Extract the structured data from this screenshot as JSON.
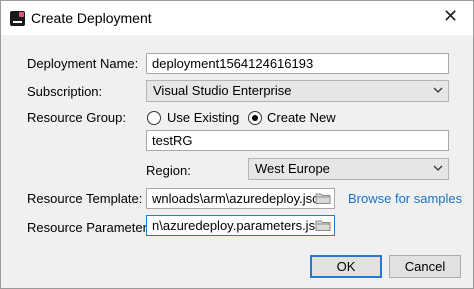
{
  "window": {
    "title": "Create Deployment",
    "close_glyph": "✕"
  },
  "form": {
    "deployment_name_label": "Deployment Name:",
    "deployment_name_value": "deployment1564124616193",
    "subscription_label": "Subscription:",
    "subscription_value": "Visual Studio Enterprise",
    "resource_group_label": "Resource Group:",
    "use_existing_label": "Use Existing",
    "create_new_label": "Create New",
    "resource_group_value": "testRG",
    "region_label": "Region:",
    "region_value": "West Europe",
    "resource_template_label": "Resource Template:",
    "resource_template_value": "wnloads\\arm\\azuredeploy.json",
    "browse_samples_label": "Browse for samples",
    "resource_parameters_label": "Resource Parameters:",
    "resource_parameters_value": "n\\azuredeploy.parameters.json"
  },
  "buttons": {
    "ok_label": "OK",
    "cancel_label": "Cancel"
  },
  "state": {
    "resource_group_mode": "create-new"
  },
  "colors": {
    "accent": "#2678d2",
    "link": "#1a73c7",
    "dialog_bg": "#f0f0f0"
  },
  "icons": [
    "app-icon",
    "close-icon",
    "chevron-down-icon",
    "folder-icon"
  ]
}
